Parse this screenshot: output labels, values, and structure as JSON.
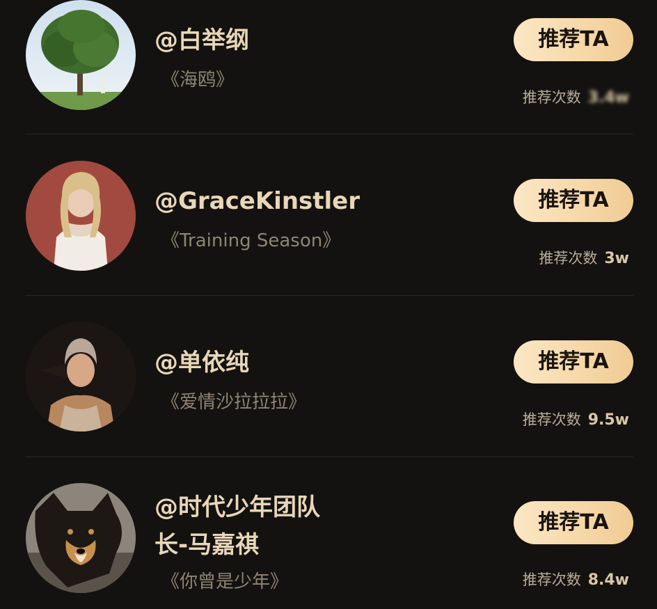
{
  "items": [
    {
      "name": "@白举纲",
      "song": "《海鸥》",
      "button_label": "推荐TA",
      "count_label": "推荐次数",
      "count_value": "3.4w",
      "count_partially_obscured": true
    },
    {
      "name": "@GraceKinstler",
      "song": "《Training Season》",
      "button_label": "推荐TA",
      "count_label": "推荐次数",
      "count_value": "3w"
    },
    {
      "name": "@单依纯",
      "song": "《爱情沙拉拉拉》",
      "button_label": "推荐TA",
      "count_label": "推荐次数",
      "count_value": "9.5w"
    },
    {
      "name_line1": "@时代少年团队",
      "name_line2": "长-马嘉祺",
      "song": "《你曾是少年》",
      "button_label": "推荐TA",
      "count_label": "推荐次数",
      "count_value": "8.4w"
    }
  ],
  "colors": {
    "background": "#141210",
    "name_text": "#e8d7b8",
    "song_text": "#8f8474",
    "button_gradient_start": "#fbe7c4",
    "button_gradient_end": "#f0cb94",
    "button_text": "#1a1410",
    "divider": "#2a2622"
  }
}
